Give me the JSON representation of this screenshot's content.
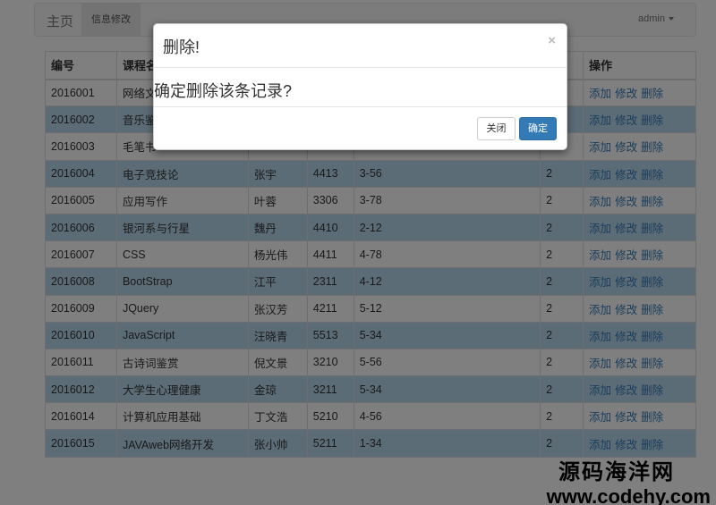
{
  "navbar": {
    "brand": "主页",
    "active_tab": "信息修改",
    "user": "admin"
  },
  "table": {
    "headers": [
      "编号",
      "课程名",
      "",
      "",
      "",
      "",
      "操作"
    ],
    "action_labels": [
      "添加",
      "修改",
      "删除"
    ],
    "rows": [
      [
        "2016001",
        "网络文",
        "",
        "",
        "",
        ""
      ],
      [
        "2016002",
        "音乐鉴",
        "",
        "",
        "",
        ""
      ],
      [
        "2016003",
        "毛笔书",
        "",
        "",
        "",
        ""
      ],
      [
        "2016004",
        "电子竞技论",
        "张宇",
        "4413",
        "3-56",
        "2"
      ],
      [
        "2016005",
        "应用写作",
        "叶蓉",
        "3306",
        "3-78",
        "2"
      ],
      [
        "2016006",
        "银河系与行星",
        "魏丹",
        "4410",
        "2-12",
        "2"
      ],
      [
        "2016007",
        "CSS",
        "杨光伟",
        "4411",
        "4-78",
        "2"
      ],
      [
        "2016008",
        "BootStrap",
        "江平",
        "2311",
        "4-12",
        "2"
      ],
      [
        "2016009",
        "JQuery",
        "张汉芳",
        "4211",
        "5-12",
        "2"
      ],
      [
        "2016010",
        "JavaScript",
        "汪晓青",
        "5513",
        "5-34",
        "2"
      ],
      [
        "2016011",
        "古诗词鉴赏",
        "倪文景",
        "3210",
        "5-56",
        "2"
      ],
      [
        "2016012",
        "大学生心理健康",
        "金琼",
        "3211",
        "5-34",
        "2"
      ],
      [
        "2016014",
        "计算机应用基础",
        "丁文浩",
        "5210",
        "4-56",
        "2"
      ],
      [
        "2016015",
        "JAVAweb网络开发",
        "张小帅",
        "5211",
        "1-34",
        "2"
      ]
    ]
  },
  "modal": {
    "title": "删除!",
    "close_symbol": "×",
    "message": "确定删除该条记录?",
    "cancel_label": "关闭",
    "confirm_label": "确定"
  },
  "watermark": {
    "line1": "源码海洋网",
    "line2": "www.codehy.com"
  }
}
